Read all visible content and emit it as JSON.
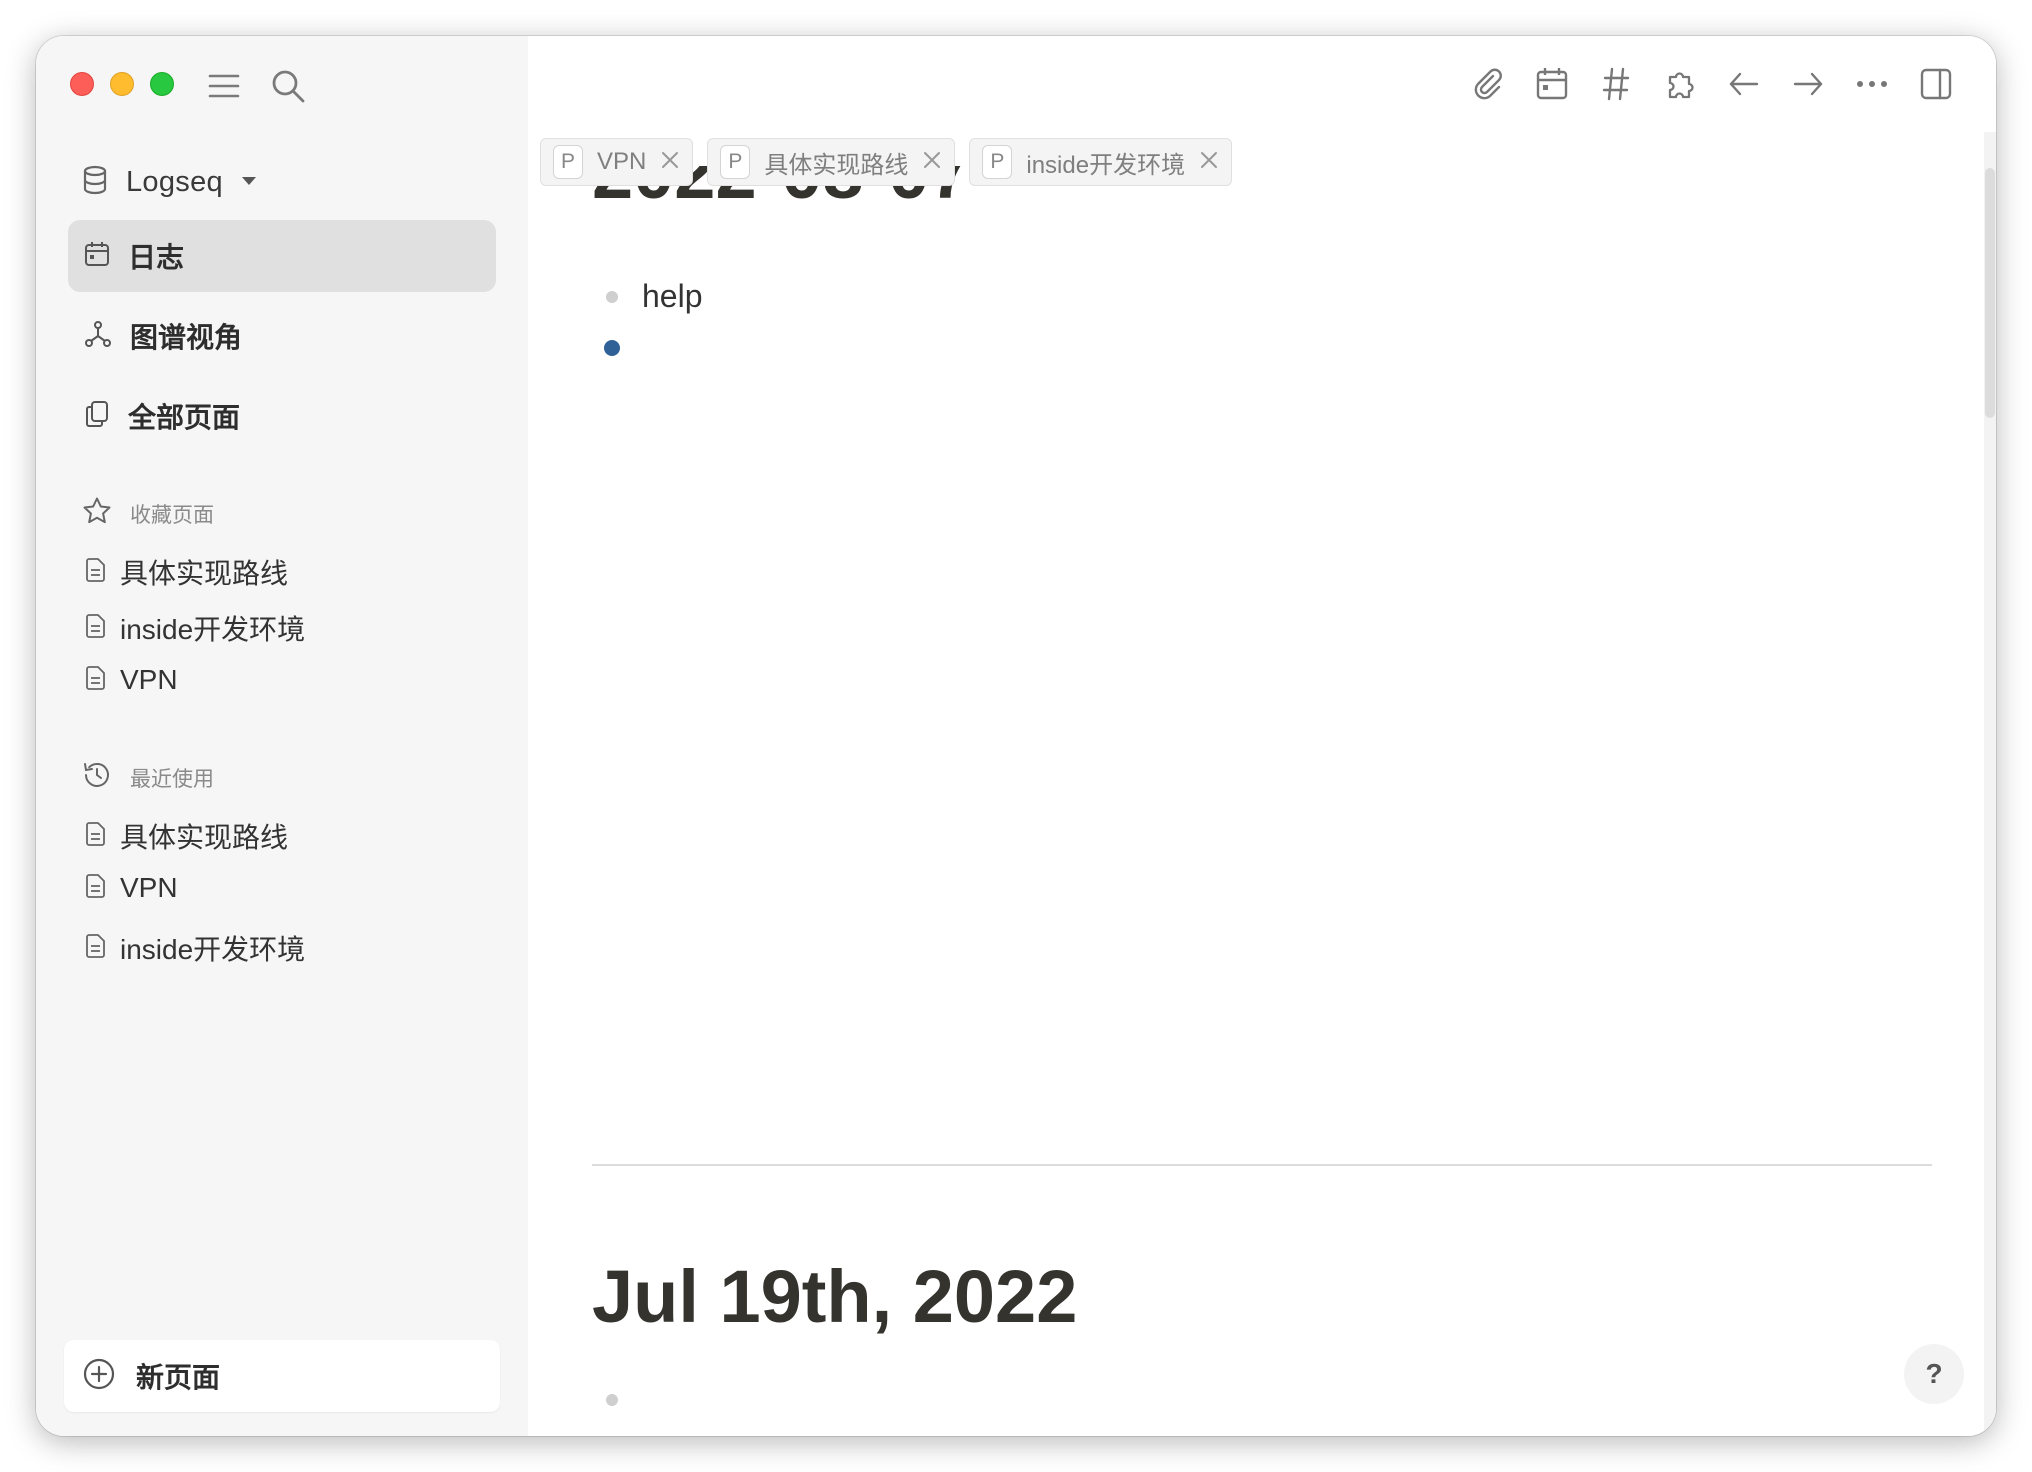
{
  "sidebar": {
    "graph_name": "Logseq",
    "nav": [
      {
        "label": "日志",
        "icon": "calendar-icon",
        "active": true
      },
      {
        "label": "图谱视角",
        "icon": "graph-icon"
      },
      {
        "label": "全部页面",
        "icon": "pages-icon"
      }
    ],
    "favorites": {
      "title": "收藏页面",
      "items": [
        "具体实现路线",
        "inside开发环境",
        "VPN"
      ]
    },
    "recent": {
      "title": "最近使用",
      "items": [
        "具体实现路线",
        "VPN",
        "inside开发环境"
      ]
    },
    "new_page_label": "新页面"
  },
  "main": {
    "toolbar_icons": [
      "paperclip-icon",
      "calendar-icon",
      "hashtag-icon",
      "puzzle-icon",
      "arrow-left-icon",
      "arrow-right-icon",
      "more-icon",
      "sidebar-toggle-icon"
    ],
    "tabs": [
      {
        "badge": "P",
        "label": "VPN"
      },
      {
        "badge": "P",
        "label": "具体实现路线"
      },
      {
        "badge": "P",
        "label": "inside开发环境"
      }
    ],
    "current_journal_title": "2022-08-07",
    "blocks": [
      {
        "text": "help"
      },
      {
        "text": ""
      }
    ],
    "next_journal_title": "Jul 19th, 2022",
    "next_blocks": [
      {
        "text": ""
      }
    ],
    "help_label": "?"
  },
  "colors": {
    "sidebar_bg": "#f6f6f6",
    "active_nav_bg": "#e0e0e0",
    "bullet_active": "#2f6096",
    "title_text": "#35332e"
  }
}
